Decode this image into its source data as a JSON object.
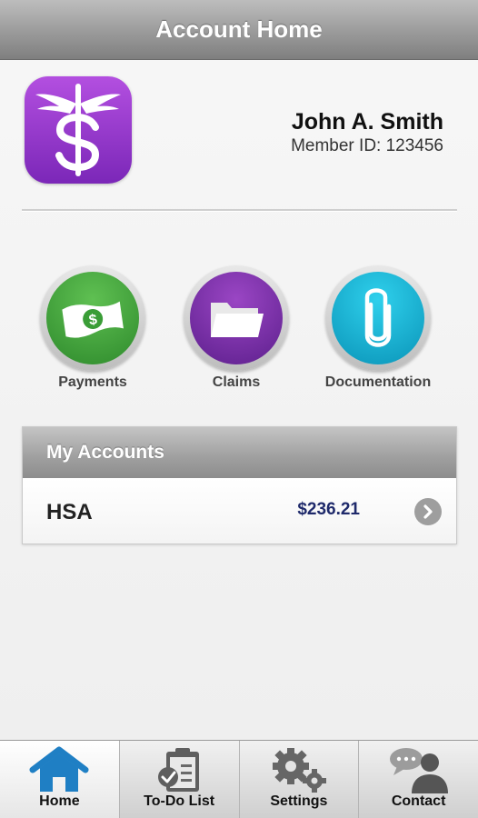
{
  "header": {
    "title": "Account Home"
  },
  "profile": {
    "logo_icon": "caduceus-dollar-icon",
    "name": "John A. Smith",
    "member_id": "Member ID: 123456"
  },
  "actions": [
    {
      "label": "Payments",
      "icon": "money-bill-icon",
      "color": "#3a9d37"
    },
    {
      "label": "Claims",
      "icon": "folder-icon",
      "color": "#6e2a9e"
    },
    {
      "label": "Documentation",
      "icon": "paperclip-icon",
      "color": "#16b2d8"
    }
  ],
  "accounts": {
    "header": "My Accounts",
    "rows": [
      {
        "name": "HSA",
        "balance": "$236.21"
      }
    ]
  },
  "tabs": [
    {
      "label": "Home",
      "icon": "home-icon",
      "active": true
    },
    {
      "label": "To-Do List",
      "icon": "clipboard-check-icon",
      "active": false
    },
    {
      "label": "Settings",
      "icon": "gears-icon",
      "active": false
    },
    {
      "label": "Contact",
      "icon": "chat-person-icon",
      "active": false
    }
  ],
  "colors": {
    "accent_blue": "#1f7fc4",
    "balance_navy": "#1f2a6b",
    "logo_purple": "#9b3fd0"
  }
}
